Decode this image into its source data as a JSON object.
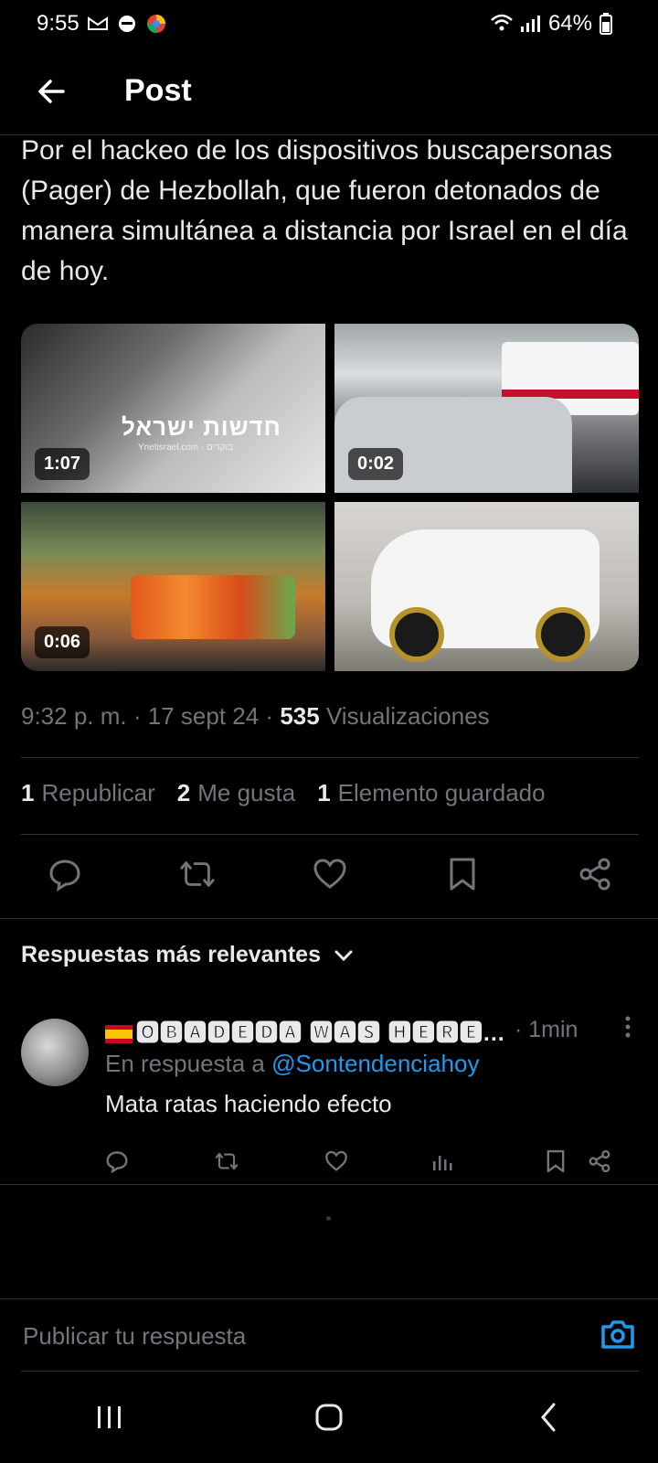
{
  "status_bar": {
    "time": "9:55",
    "battery": "64%"
  },
  "header": {
    "title": "Post"
  },
  "post": {
    "text": "Por el hackeo de los dispositivos buscapersonas (Pager) de Hezbollah, que fueron detonados de manera simultánea a distancia por Israel en el día de hoy.",
    "media": [
      {
        "duration": "1:07",
        "overlay_text": "חדשות ישראל",
        "overlay_sub": "Ynetisrael.com · בוקרים"
      },
      {
        "duration": "0:02"
      },
      {
        "duration": "0:06"
      },
      {
        "duration": ""
      }
    ],
    "time": "9:32 p. m.",
    "date": "17 sept 24",
    "views_count": "535",
    "views_label": "Visualizaciones",
    "reposts_count": "1",
    "reposts_label": "Republicar",
    "likes_count": "2",
    "likes_label": "Me gusta",
    "bookmarks_count": "1",
    "bookmarks_label": "Elemento guardado"
  },
  "replies": {
    "header": "Respuestas más relevantes",
    "items": [
      {
        "name": "🅾🅱🅰🅳🅴🅳🅰 🆆🅰🆂 🅷🅴🆁🅴...",
        "time": "· 1min",
        "context_prefix": "En respuesta a",
        "context_handle": "@Sontendenciahoy",
        "text": "Mata ratas haciendo efecto"
      }
    ]
  },
  "composer": {
    "placeholder": "Publicar tu respuesta"
  },
  "colors": {
    "accent": "#1d9bf0",
    "background": "#000000",
    "muted": "#71767b"
  }
}
